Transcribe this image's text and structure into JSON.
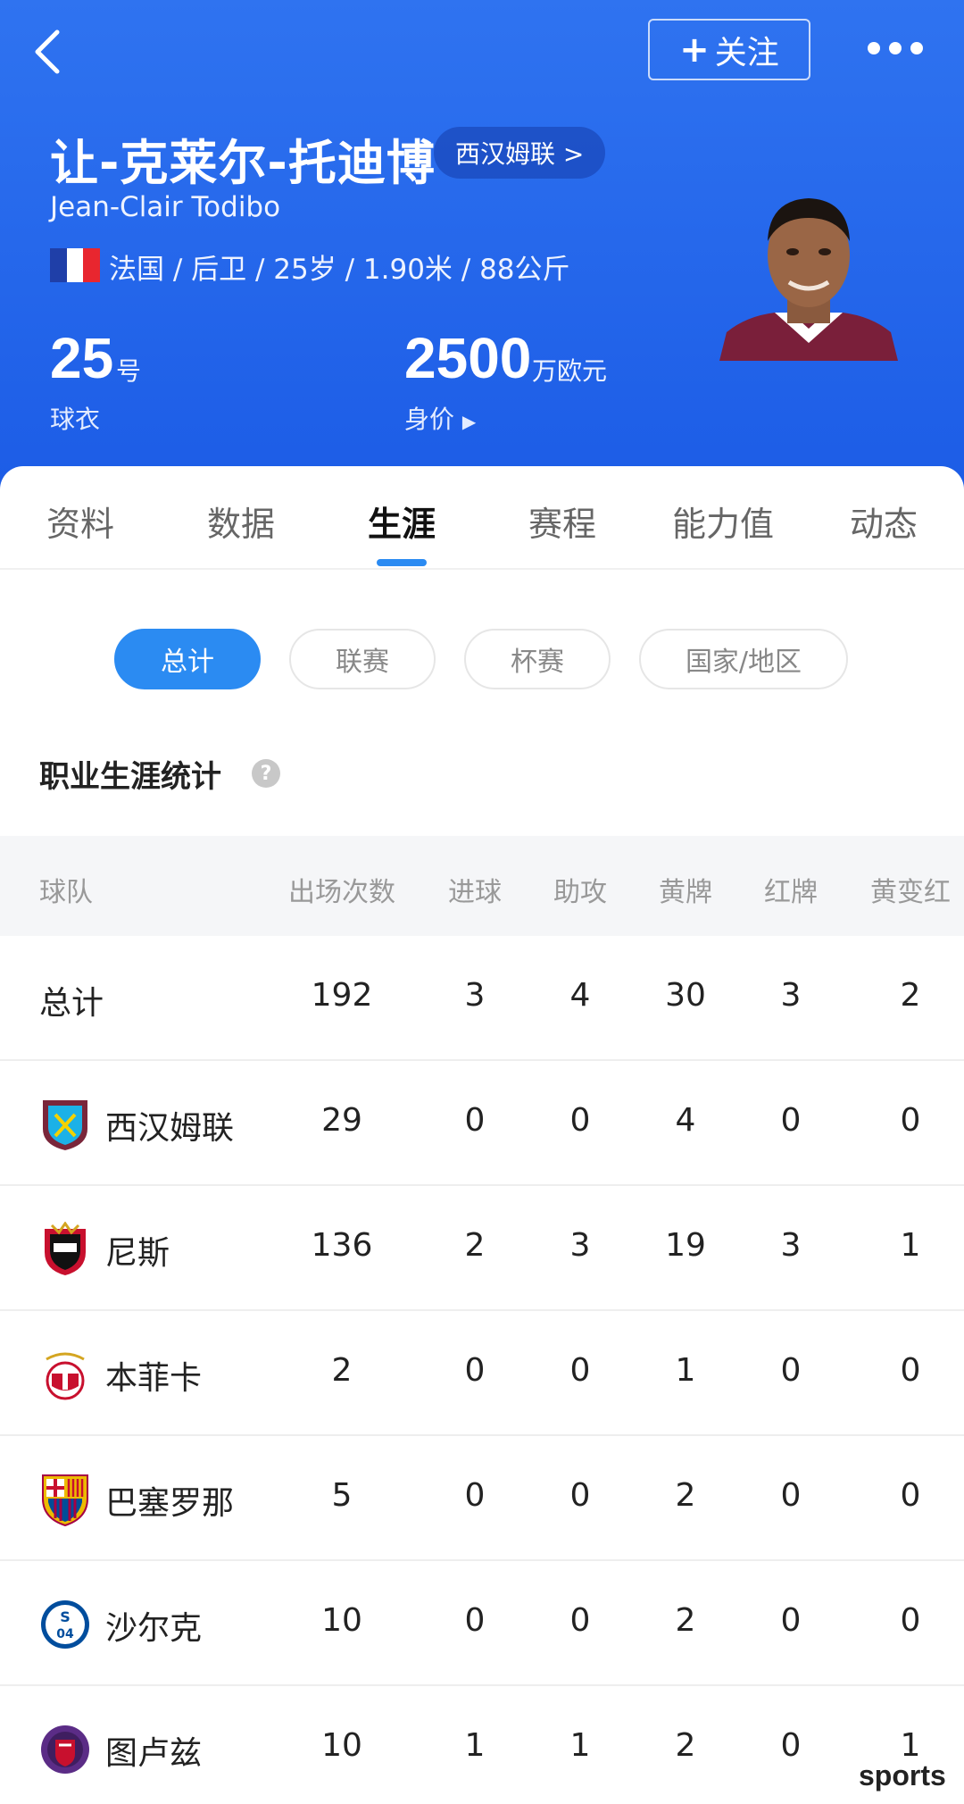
{
  "header": {
    "follow_label": "关注",
    "name_cn": "让-克莱尔-托迪博",
    "club_pill": "西汉姆联 >",
    "name_en": "Jean-Clair Todibo",
    "info": "法国 / 后卫 / 25岁 / 1.90米 / 88公斤",
    "shirt_number": "25",
    "shirt_unit": "号",
    "shirt_label": "球衣",
    "value_number": "2500",
    "value_unit": "万欧元",
    "value_label": "身价"
  },
  "tabs": [
    {
      "label": "资料"
    },
    {
      "label": "数据"
    },
    {
      "label": "生涯"
    },
    {
      "label": "赛程"
    },
    {
      "label": "能力值"
    },
    {
      "label": "动态"
    }
  ],
  "filters": [
    {
      "label": "总计"
    },
    {
      "label": "联赛"
    },
    {
      "label": "杯赛"
    },
    {
      "label": "国家/地区"
    }
  ],
  "section_title": "职业生涯统计",
  "table": {
    "headers": [
      "球队",
      "出场次数",
      "进球",
      "助攻",
      "黄牌",
      "红牌",
      "黄变红"
    ],
    "rows": [
      {
        "team": "总计",
        "apps": "192",
        "goals": "3",
        "assists": "4",
        "yellow": "30",
        "red": "3",
        "second_yellow": "2"
      },
      {
        "team": "西汉姆联",
        "apps": "29",
        "goals": "0",
        "assists": "0",
        "yellow": "4",
        "red": "0",
        "second_yellow": "0"
      },
      {
        "team": "尼斯",
        "apps": "136",
        "goals": "2",
        "assists": "3",
        "yellow": "19",
        "red": "3",
        "second_yellow": "1"
      },
      {
        "team": "本菲卡",
        "apps": "2",
        "goals": "0",
        "assists": "0",
        "yellow": "1",
        "red": "0",
        "second_yellow": "0"
      },
      {
        "team": "巴塞罗那",
        "apps": "5",
        "goals": "0",
        "assists": "0",
        "yellow": "2",
        "red": "0",
        "second_yellow": "0"
      },
      {
        "team": "沙尔克",
        "apps": "10",
        "goals": "0",
        "assists": "0",
        "yellow": "2",
        "red": "0",
        "second_yellow": "0"
      },
      {
        "team": "图卢兹",
        "apps": "10",
        "goals": "1",
        "assists": "1",
        "yellow": "2",
        "red": "0",
        "second_yellow": "1"
      }
    ]
  },
  "watermark": "sports",
  "colors": {
    "header_blue": "#2f73f0",
    "accent": "#2b8bf2"
  }
}
